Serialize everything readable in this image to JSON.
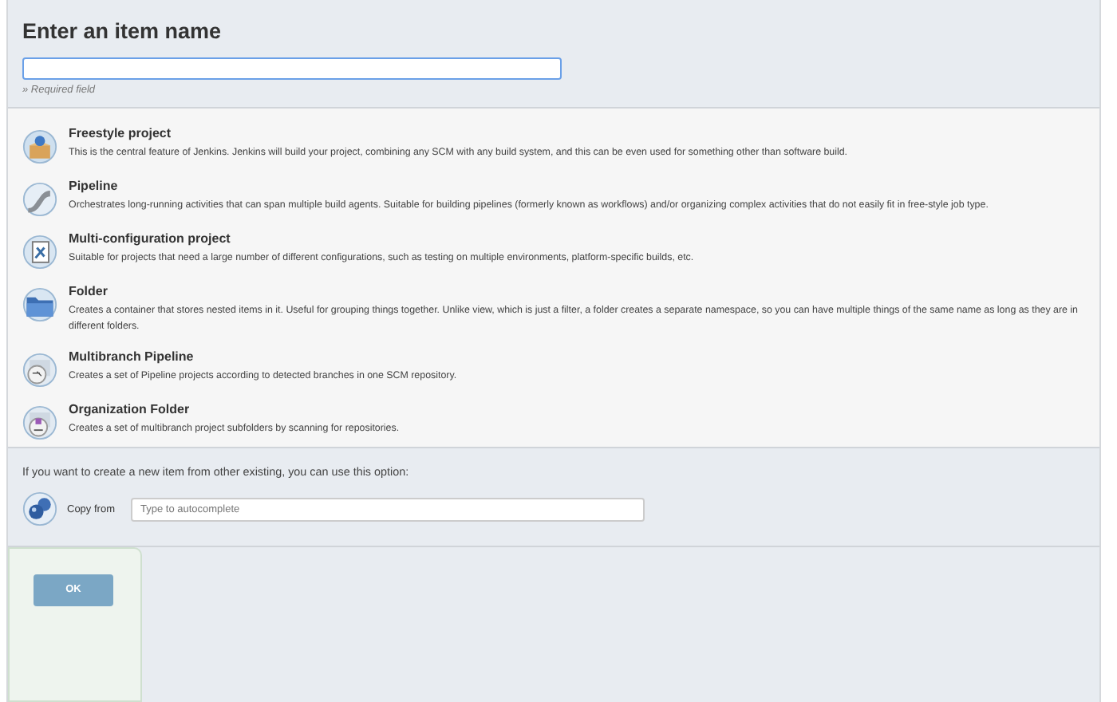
{
  "name_section": {
    "title": "Enter an item name",
    "hint": "» Required field"
  },
  "item_types": [
    {
      "name": "Freestyle project",
      "description": "This is the central feature of Jenkins. Jenkins will build your project, combining any SCM with any build system, and this can be even used for something other than software build."
    },
    {
      "name": "Pipeline",
      "description": "Orchestrates long-running activities that can span multiple build agents. Suitable for building pipelines (formerly known as workflows) and/or organizing complex activities that do not easily fit in free-style job type."
    },
    {
      "name": "Multi-configuration project",
      "description": "Suitable for projects that need a large number of different configurations, such as testing on multiple environments, platform-specific builds, etc."
    },
    {
      "name": "Folder",
      "description": "Creates a container that stores nested items in it. Useful for grouping things together. Unlike view, which is just a filter, a folder creates a separate namespace, so you can have multiple things of the same name as long as they are in different folders."
    },
    {
      "name": "Multibranch Pipeline",
      "description": "Creates a set of Pipeline projects according to detected branches in one SCM repository."
    },
    {
      "name": "Organization Folder",
      "description": "Creates a set of multibranch project subfolders by scanning for repositories."
    }
  ],
  "copy_section": {
    "text": "If you want to create a new item from other existing, you can use this option:",
    "label": "Copy from",
    "placeholder": "Type to autocomplete"
  },
  "ok_button": "OK"
}
